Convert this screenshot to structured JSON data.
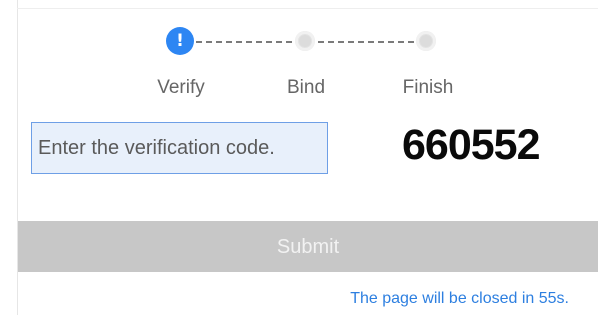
{
  "stepper": {
    "steps": [
      {
        "label": "Verify",
        "state": "active",
        "icon": "exclamation-icon",
        "icon_glyph": "!"
      },
      {
        "label": "Bind",
        "state": "inactive"
      },
      {
        "label": "Finish",
        "state": "inactive"
      }
    ]
  },
  "form": {
    "input_value": "",
    "input_placeholder": "Enter the verification code.",
    "verification_code": "660552",
    "submit_label": "Submit"
  },
  "notice": {
    "text": "The page will be closed in 55s."
  },
  "colors": {
    "accent": "#2d86f3",
    "notice": "#2d7fe0",
    "button_disabled": "#c7c7c7",
    "input_background": "#e8f0fb",
    "input_border": "#6e9fe6"
  }
}
